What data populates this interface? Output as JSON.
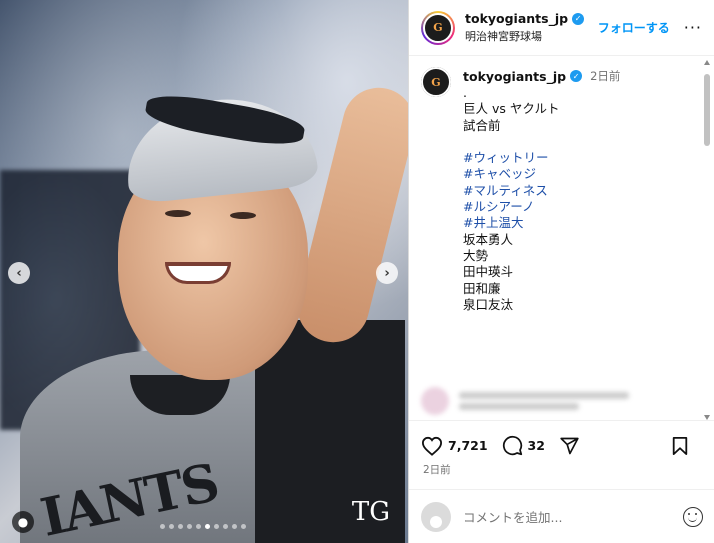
{
  "photo": {
    "jersey_text": "IANTS",
    "watermark": "TG",
    "carousel": {
      "total": 10,
      "active_index": 5
    }
  },
  "header": {
    "username": "tokyogiants_jp",
    "location": "明治神宮野球場",
    "follow_label": "フォローする",
    "more_label": "···",
    "avatar_text": "G"
  },
  "caption": {
    "username": "tokyogiants_jp",
    "time": "2日前",
    "lines": [
      {
        "text": ".",
        "kind": "plain"
      },
      {
        "text": "巨人 vs ヤクルト",
        "kind": "plain"
      },
      {
        "text": "試合前",
        "kind": "plain"
      },
      {
        "text": "",
        "kind": "blank"
      },
      {
        "text": "#ウィットリー",
        "kind": "tag"
      },
      {
        "text": "#キャベッジ",
        "kind": "tag"
      },
      {
        "text": "#マルティネス",
        "kind": "tag"
      },
      {
        "text": "#ルシアーノ",
        "kind": "tag"
      },
      {
        "text": "#井上温大",
        "kind": "tag"
      },
      {
        "text": "坂本勇人",
        "kind": "plain"
      },
      {
        "text": "大勢",
        "kind": "plain"
      },
      {
        "text": "田中瑛斗",
        "kind": "plain"
      },
      {
        "text": "田和廉",
        "kind": "plain"
      },
      {
        "text": "泉口友汰",
        "kind": "plain"
      }
    ]
  },
  "actions": {
    "likes": "7,721",
    "comments": "32"
  },
  "post_date": "2日前",
  "comment_box": {
    "placeholder": "コメントを追加..."
  },
  "colors": {
    "link": "#0095f6",
    "hashtag": "#1e4fa8",
    "muted": "#737373"
  }
}
